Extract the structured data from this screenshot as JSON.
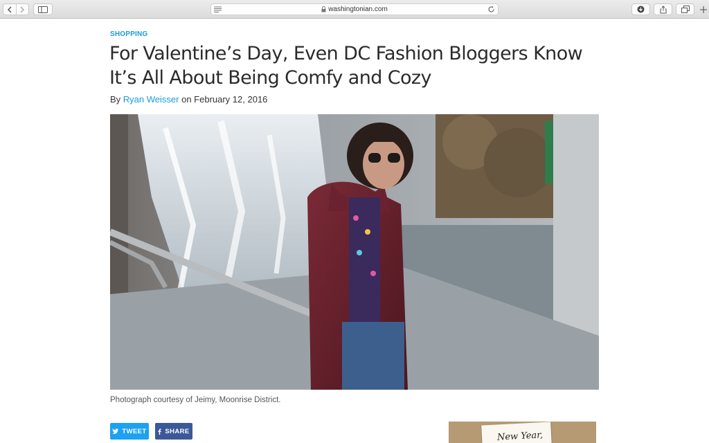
{
  "browser": {
    "url": "washingtonian.com"
  },
  "article": {
    "category": "SHOPPING",
    "headline": "For Valentine’s Day, Even DC Fashion Bloggers Know It’s All About Being Comfy and Cozy",
    "byline_prefix": "By ",
    "author": "Ryan Weisser",
    "byline_date": " on February 12, 2016",
    "caption": "Photograph courtesy of Jeimy, Moonrise District."
  },
  "social": {
    "tweet_label": "TWEET",
    "share_label": "SHARE"
  },
  "sidebar": {
    "thumb_text": "New Year,"
  },
  "colors": {
    "link": "#1a9bd7",
    "twitter": "#1da1f2",
    "facebook": "#3b5998"
  }
}
